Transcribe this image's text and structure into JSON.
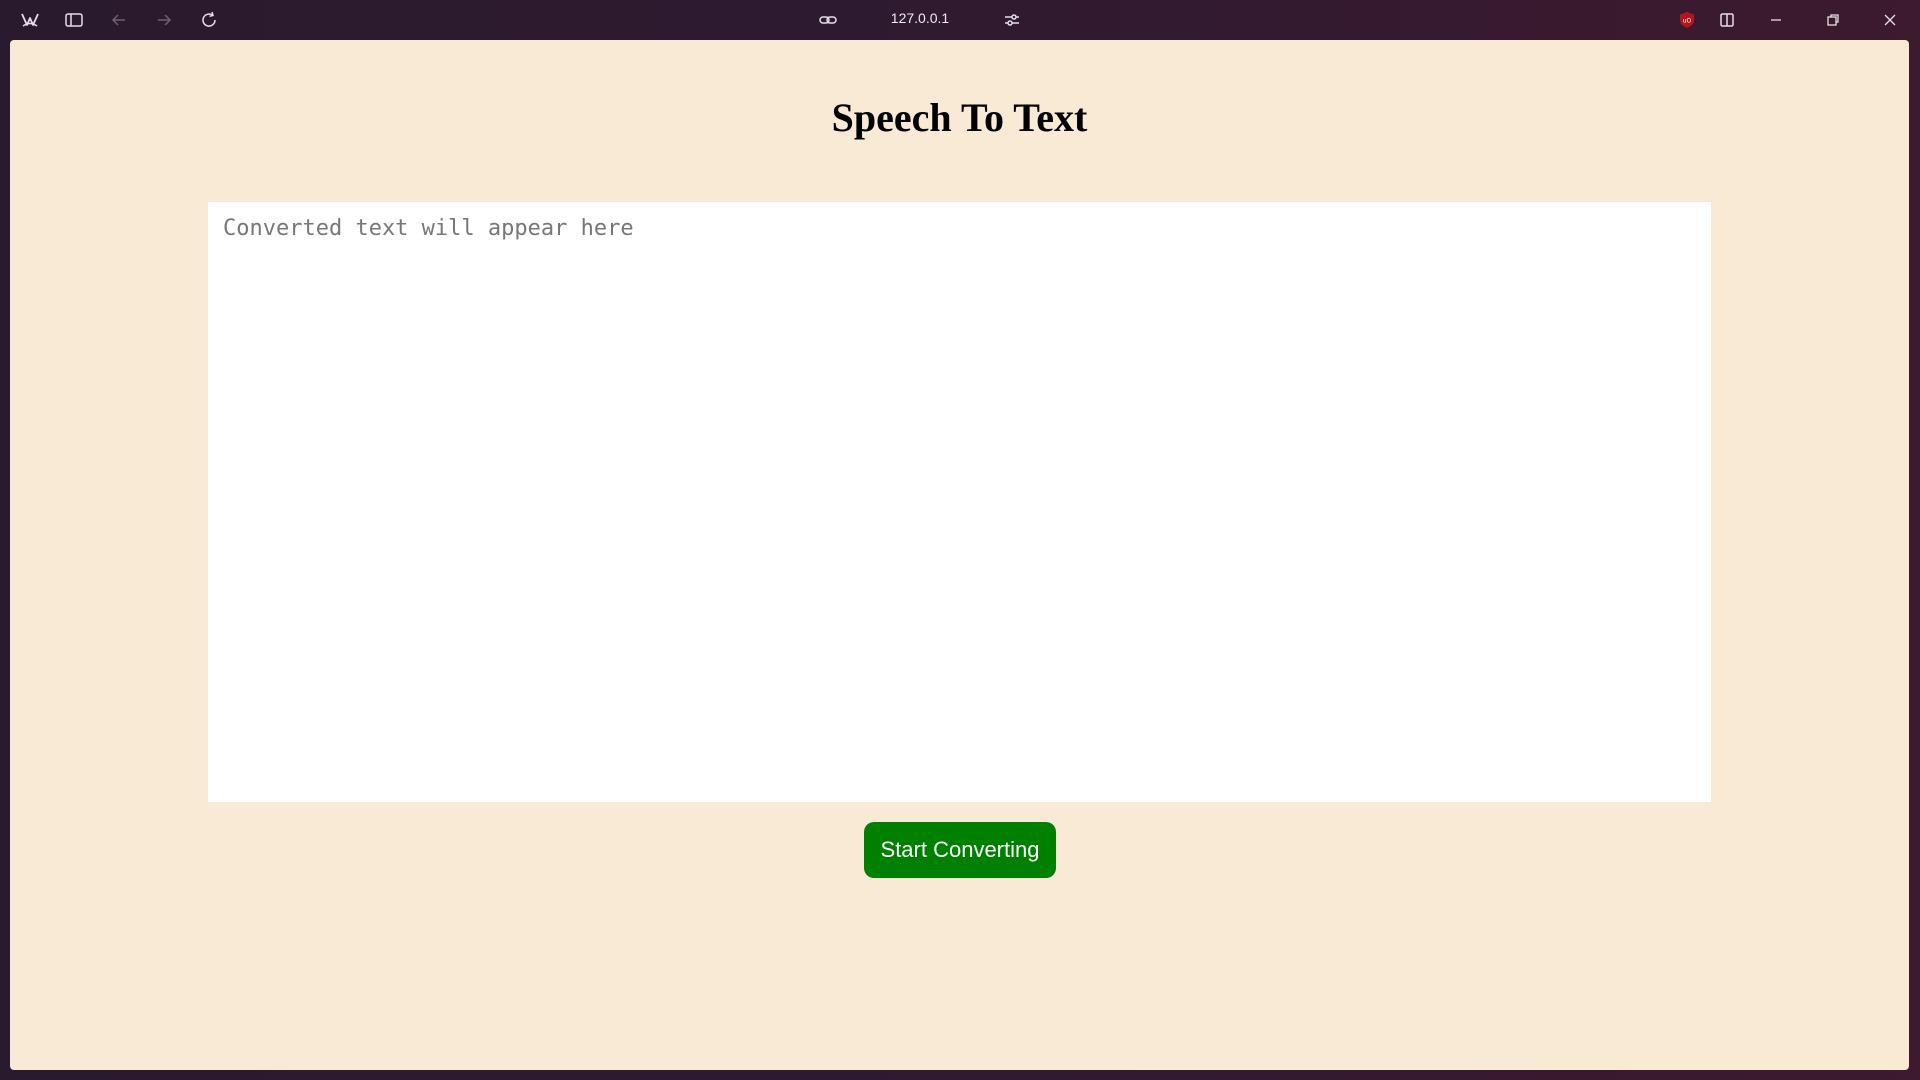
{
  "browser": {
    "url": "127.0.0.1",
    "icons": {
      "app": "browser-logo-icon",
      "sidebar": "sidebar-toggle-icon",
      "back": "back-arrow-icon",
      "forward": "forward-arrow-icon",
      "reload": "reload-icon",
      "link": "link-icon",
      "settings": "site-settings-icon",
      "ublock": "ublock-origin-icon",
      "split": "split-view-icon",
      "minimize": "minimize-icon",
      "restore": "restore-icon",
      "close": "close-icon"
    }
  },
  "page": {
    "title": "Speech To Text",
    "textarea": {
      "placeholder": "Converted text will appear here",
      "value": ""
    },
    "button_label": "Start Converting"
  },
  "colors": {
    "page_background": "#f9ead6",
    "button_background": "#008000",
    "button_text": "#ffffff"
  }
}
